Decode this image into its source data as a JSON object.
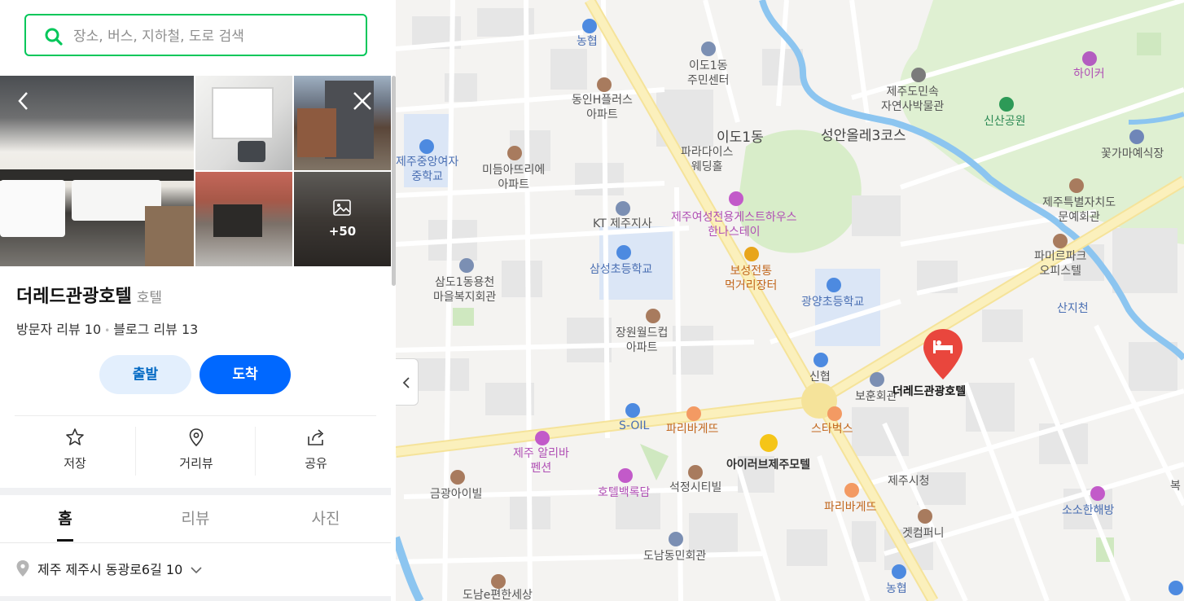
{
  "search": {
    "placeholder": "장소, 버스, 지하철, 도로 검색"
  },
  "gallery": {
    "more_label": "+50"
  },
  "place": {
    "name": "더레드관광호텔",
    "category": "호텔",
    "visitor_reviews": "방문자 리뷰 10",
    "blog_reviews": "블로그 리뷰 13"
  },
  "route": {
    "depart_label": "출발",
    "arrive_label": "도착"
  },
  "actions": {
    "save_label": "저장",
    "street_label": "거리뷰",
    "share_label": "공유"
  },
  "tabs": [
    {
      "label": "홈"
    },
    {
      "label": "리뷰"
    },
    {
      "label": "사진"
    }
  ],
  "address": "제주 제주시 동광로6길 10",
  "colors": {
    "accent_green": "#03c75a",
    "primary_blue": "#0068ff",
    "marker_red": "#e9463d"
  },
  "map_labels": {
    "nonghyup1": "농협",
    "ido1_center": "이도1동",
    "ido1_center2": "주민센터",
    "jeju_folk": "제주도민속",
    "jeju_folk2": "자연사박물관",
    "hiker": "하이커",
    "donginh": "동인H플러스",
    "donginh2": "아파트",
    "shinsan_park": "신산공원",
    "ido1_district": "이도1동",
    "seongan": "성안올레3코스",
    "flower_wedding": "꽃가마예식장",
    "jeju_girls_mid": "제주중앙여자",
    "jeju_girls_mid2": "중학교",
    "midem": "미듬아뜨리에",
    "midem2": "아파트",
    "paradise": "파라다이스",
    "paradise2": "웨딩홀",
    "jeju_culture": "제주특별자치도",
    "jeju_culture2": "문예회관",
    "kt": "KT 제주지사",
    "women_guesthouse": "제주여성전용게스트하우스",
    "women_guesthouse2": "한나스테이",
    "family_park": "파미르파크",
    "family_park2": "오피스텔",
    "samdo": "삼도1동용천",
    "samdo2": "마을복지회관",
    "samsung_elem": "삼성초등학교",
    "boseong": "보성전통",
    "boseong2": "먹거리장터",
    "gwangyang_elem": "광양초등학교",
    "sanjicheon": "산지천",
    "jangwon": "장원월드컵",
    "jangwon2": "아파트",
    "shinhyup": "신협",
    "bohun": "보훈회관",
    "hotel": "더레드관광호텔",
    "soil": "S-OIL",
    "paris1": "파리바게뜨",
    "starbucks": "스타벅스",
    "jeju_alibaba": "제주 알리바",
    "jeju_alibaba2": "펜션",
    "iloveu": "아이러브제주모텔",
    "jeju_city_hall": "제주시청",
    "geumgwang": "금광아이빌",
    "hotel_baekrokdam": "호텔백록담",
    "seokjeong": "석정시티빌",
    "paris2": "파리바게뜨",
    "sosohan": "소소한해방",
    "gekompany": "겟컴퍼니",
    "donam": "도남동민회관",
    "nonghyup2": "농협",
    "donam_e": "도남e편한세상",
    "bok": "복"
  }
}
